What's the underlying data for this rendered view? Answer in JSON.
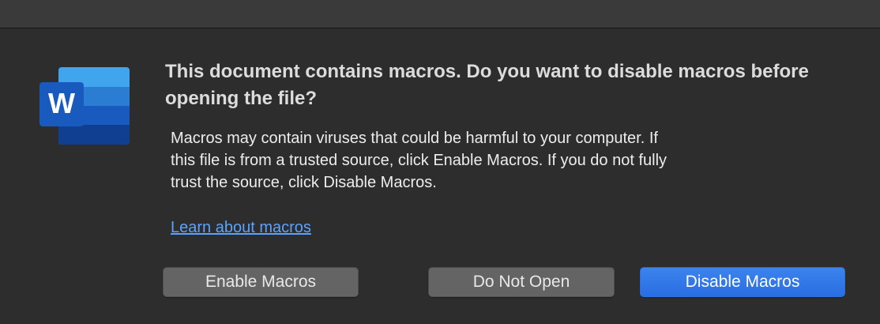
{
  "dialog": {
    "app_icon": {
      "name": "word-icon",
      "letter": "W"
    },
    "headline": "This document contains macros. Do you want to disable macros before opening the file?",
    "body": "Macros may contain viruses that could be harmful to your computer.  If\nthis file is from a trusted source, click Enable Macros. If you do not fully\ntrust the source, click Disable Macros.",
    "learn_link": "Learn about macros",
    "buttons": {
      "enable": "Enable Macros",
      "do_not_open": "Do Not Open",
      "disable": "Disable Macros"
    }
  },
  "colors": {
    "background": "#2d2d2d",
    "link": "#5aa3ff",
    "primary_button": "#2a6ee2",
    "secondary_button": "#646464"
  }
}
